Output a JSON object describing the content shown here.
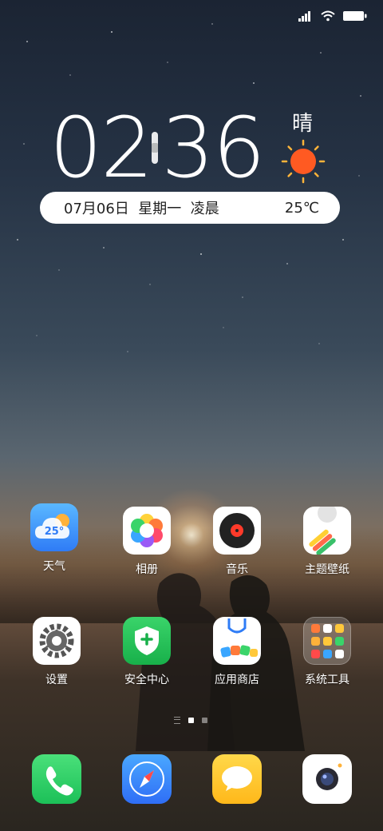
{
  "status_bar": {
    "icons": [
      "signal-icon",
      "wifi-icon",
      "battery-icon"
    ]
  },
  "clock": {
    "hours": "02",
    "minutes": "36"
  },
  "weather": {
    "condition": "晴",
    "icon": "sun-icon",
    "temperature": "25℃"
  },
  "date_bar": {
    "date": "07月06日  星期一  凌晨"
  },
  "apps_row1": [
    {
      "label": "天气",
      "icon": "weather-app-icon",
      "badge_text": "25°"
    },
    {
      "label": "相册",
      "icon": "gallery-app-icon"
    },
    {
      "label": "音乐",
      "icon": "music-app-icon"
    },
    {
      "label": "主题壁纸",
      "icon": "themes-app-icon"
    }
  ],
  "apps_row2": [
    {
      "label": "设置",
      "icon": "settings-app-icon"
    },
    {
      "label": "安全中心",
      "icon": "security-app-icon"
    },
    {
      "label": "应用商店",
      "icon": "app-store-icon"
    },
    {
      "label": "系统工具",
      "icon": "system-tools-folder-icon"
    }
  ],
  "page_indicator": {
    "pages": 2,
    "current": 1
  },
  "dock": [
    {
      "icon": "phone-icon"
    },
    {
      "icon": "browser-icon"
    },
    {
      "icon": "messages-icon"
    },
    {
      "icon": "camera-icon"
    }
  ],
  "colors": {
    "accent": "#2f7cf6",
    "weather_sun": "#ff6a2a"
  }
}
